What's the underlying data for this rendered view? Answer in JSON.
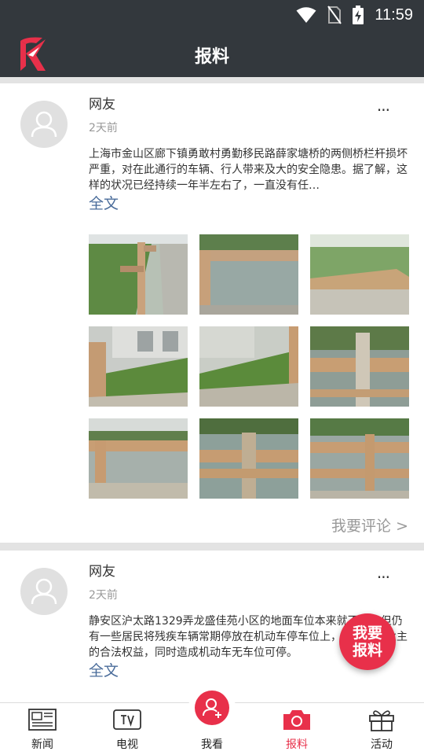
{
  "status_bar": {
    "time": "11:59"
  },
  "header": {
    "title": "报料"
  },
  "posts": [
    {
      "username": "网友",
      "time": "2天前",
      "more": "...",
      "text": "上海市金山区廊下镇勇敢村勇勤移民路薛家塘桥的两侧桥栏杆损坏严重，对在此通行的车辆、行人带来及大的安全隐患。据了解，这样的状况已经持续一年半左右了，一直没有任…",
      "full_text_label": "全文",
      "comment_label": "我要评论 >",
      "photos": [
        "photo-1",
        "photo-2",
        "photo-3",
        "photo-4",
        "photo-5",
        "photo-6",
        "photo-7",
        "photo-8",
        "photo-9"
      ]
    },
    {
      "username": "网友",
      "time": "2天前",
      "more": "...",
      "text": "静安区沪太路1329弄龙盛佳苑小区的地面车位本来就不多，但仍有一些居民将残疾车辆常期停放在机动车停车位上，不顾其他业主的合法权益，同时造成机动车无车位可停。",
      "full_text_label": "全文"
    }
  ],
  "fab": {
    "line1": "我要",
    "line2": "报料"
  },
  "bottom_nav": {
    "items": [
      {
        "label": "新闻",
        "icon": "newspaper-icon"
      },
      {
        "label": "电视",
        "icon": "tv-icon"
      },
      {
        "label": "我看",
        "icon": "user-plus-icon"
      },
      {
        "label": "报料",
        "icon": "camera-icon",
        "active": true
      },
      {
        "label": "活动",
        "icon": "gift-icon"
      }
    ]
  },
  "colors": {
    "accent": "#e8304a",
    "header": "#33383d",
    "link": "#4b6d9b"
  }
}
